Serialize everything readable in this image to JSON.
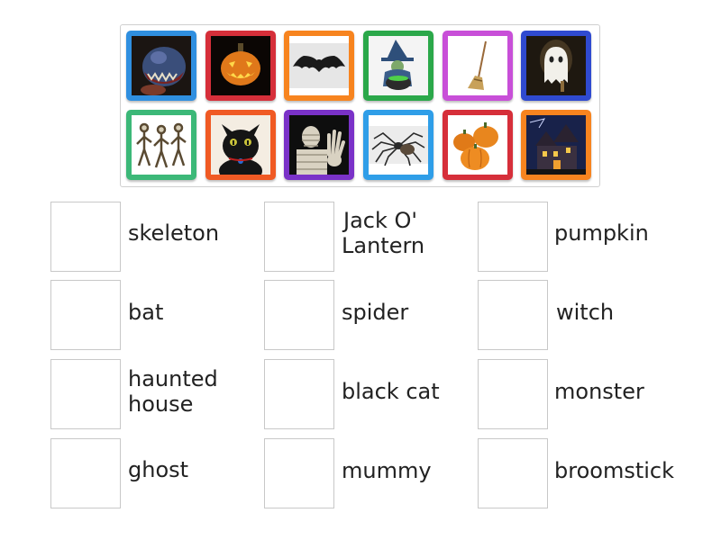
{
  "images": [
    {
      "name": "monster-image",
      "frame": "#2f8fe0"
    },
    {
      "name": "jack-o-lantern-image",
      "frame": "#d62f3a"
    },
    {
      "name": "bat-image",
      "frame": "#f7841f"
    },
    {
      "name": "witch-image",
      "frame": "#2ba84a"
    },
    {
      "name": "broomstick-image",
      "frame": "#c84fd8"
    },
    {
      "name": "ghost-image",
      "frame": "#2f4ad0"
    },
    {
      "name": "skeleton-image",
      "frame": "#3cb878"
    },
    {
      "name": "black-cat-image",
      "frame": "#f05a24"
    },
    {
      "name": "mummy-image",
      "frame": "#7a32c8"
    },
    {
      "name": "spider-image",
      "frame": "#2f9ee8"
    },
    {
      "name": "pumpkin-image",
      "frame": "#d62f3a"
    },
    {
      "name": "haunted-house-image",
      "frame": "#f7841f"
    }
  ],
  "words": [
    {
      "line1": "skeleton",
      "line2": ""
    },
    {
      "line1": "Jack O'",
      "line2": "Lantern"
    },
    {
      "line1": "pumpkin",
      "line2": ""
    },
    {
      "line1": "bat",
      "line2": ""
    },
    {
      "line1": "spider",
      "line2": ""
    },
    {
      "line1": "witch",
      "line2": ""
    },
    {
      "line1": "haunted",
      "line2": "house"
    },
    {
      "line1": "black cat",
      "line2": ""
    },
    {
      "line1": "monster",
      "line2": ""
    },
    {
      "line1": "ghost",
      "line2": ""
    },
    {
      "line1": "mummy",
      "line2": ""
    },
    {
      "line1": "broomstick",
      "line2": ""
    }
  ]
}
